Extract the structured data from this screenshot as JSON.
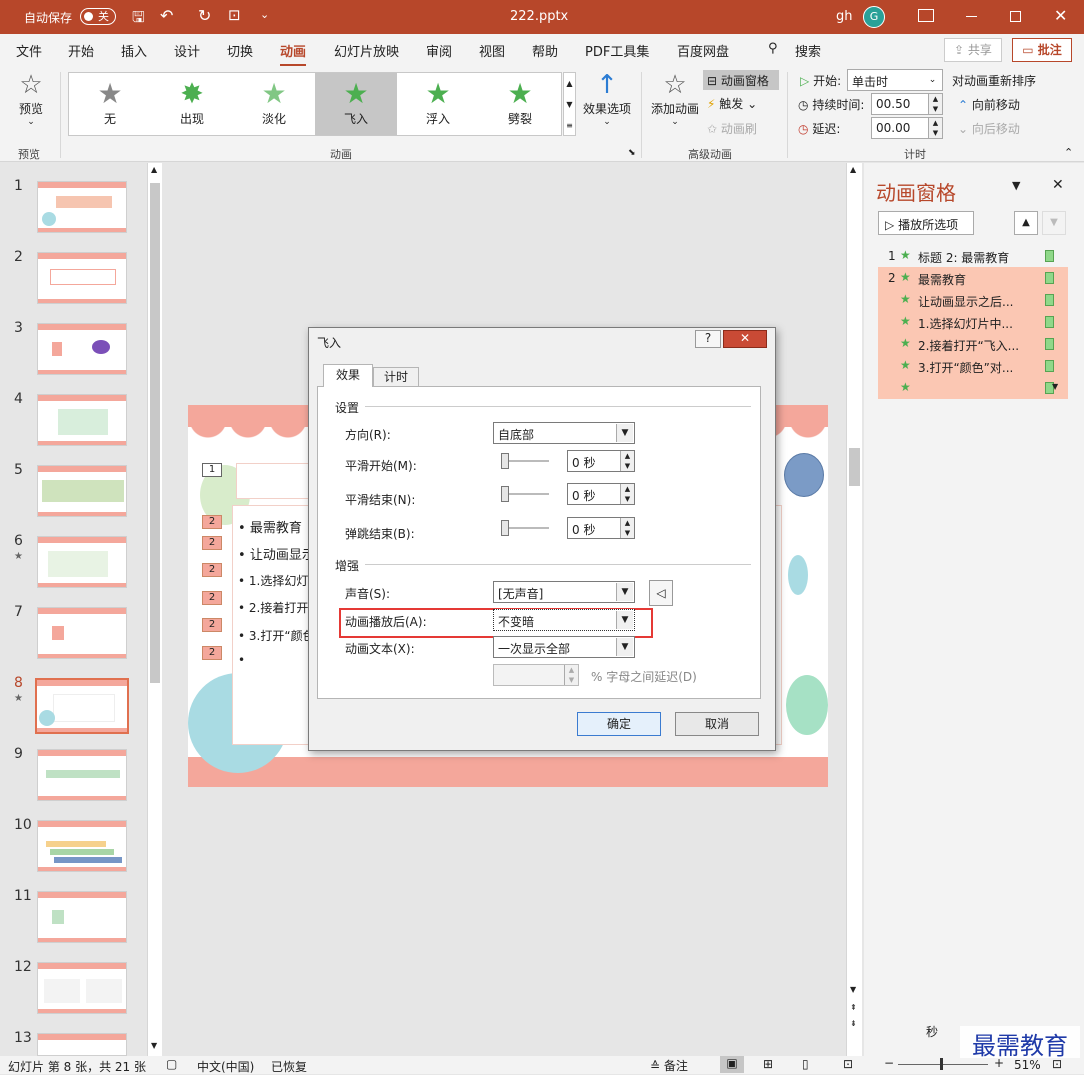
{
  "titlebar": {
    "autosave": "自动保存",
    "toggle": "关",
    "filename": "222.pptx",
    "user": "gh",
    "avatar": "G"
  },
  "tabs": [
    "文件",
    "开始",
    "插入",
    "设计",
    "切换",
    "动画",
    "幻灯片放映",
    "审阅",
    "视图",
    "帮助",
    "PDF工具集",
    "百度网盘"
  ],
  "search_label": "搜索",
  "share": "共享",
  "comment": "批注",
  "ribbon": {
    "preview": "预览",
    "preview_group": "预览",
    "effects": [
      "无",
      "出现",
      "淡化",
      "飞入",
      "浮入",
      "劈裂"
    ],
    "effect_options": "效果选项",
    "animation_group": "动画",
    "add_animation": "添加动画",
    "anim_pane": "动画窗格",
    "trigger": "触发",
    "anim_brush": "动画刷",
    "advanced_group": "高级动画",
    "start_label": "开始:",
    "start_value": "单击时",
    "duration_label": "持续时间:",
    "duration_value": "00.50",
    "delay_label": "延迟:",
    "delay_value": "00.00",
    "timing_group": "计时",
    "reorder": "对动画重新排序",
    "move_earlier": "向前移动",
    "move_later": "向后移动"
  },
  "slides": [
    "1",
    "2",
    "3",
    "4",
    "5",
    "6",
    "7",
    "8",
    "9",
    "10",
    "11",
    "12",
    "13"
  ],
  "slide_star": "★",
  "slide_content": {
    "num1": "1",
    "num2": "2",
    "bullets": [
      "最需教育",
      "让动画显示",
      "1.选择幻灯",
      "2.接着打开",
      "3.打开“颜色",
      "•"
    ]
  },
  "pane": {
    "title": "动画窗格",
    "play": "播放所选项",
    "items": [
      {
        "num": "1",
        "label": "标题 2: 最需教育"
      },
      {
        "num": "2",
        "label": "最需教育"
      },
      {
        "num": "",
        "label": "让动画显示之后..."
      },
      {
        "num": "",
        "label": "1.选择幻灯片中..."
      },
      {
        "num": "",
        "label": "2.接着打开“飞入..."
      },
      {
        "num": "",
        "label": "3.打开“颜色”对..."
      },
      {
        "num": "",
        "label": ""
      }
    ],
    "seconds": "秒"
  },
  "dialog": {
    "title": "飞入",
    "help": "?",
    "close": "✕",
    "tab_effect": "效果",
    "tab_timing": "计时",
    "section_settings": "设置",
    "direction_label": "方向(R):",
    "direction_value": "自底部",
    "smooth_start_label": "平滑开始(M):",
    "smooth_start_value": "0 秒",
    "smooth_end_label": "平滑结束(N):",
    "smooth_end_value": "0 秒",
    "bounce_end_label": "弹跳结束(B):",
    "bounce_end_value": "0 秒",
    "section_enhance": "增强",
    "sound_label": "声音(S):",
    "sound_value": "[无声音]",
    "after_label": "动画播放后(A):",
    "after_value": "不变暗",
    "text_label": "动画文本(X):",
    "text_value": "一次显示全部",
    "letter_delay": "% 字母之间延迟(D)",
    "ok": "确定",
    "cancel": "取消"
  },
  "status": {
    "slide_info": "幻灯片 第 8 张，共 21 张",
    "lang": "中文(中国)",
    "recovered": "已恢复",
    "notes": "备注",
    "zoom": "51%"
  },
  "watermark": "最需教育",
  "colors": {
    "accent": "#b7472a",
    "highlight_box": "#e53935",
    "slide_pink": "#f4a79b",
    "selected_item": "#fbc7b3"
  }
}
